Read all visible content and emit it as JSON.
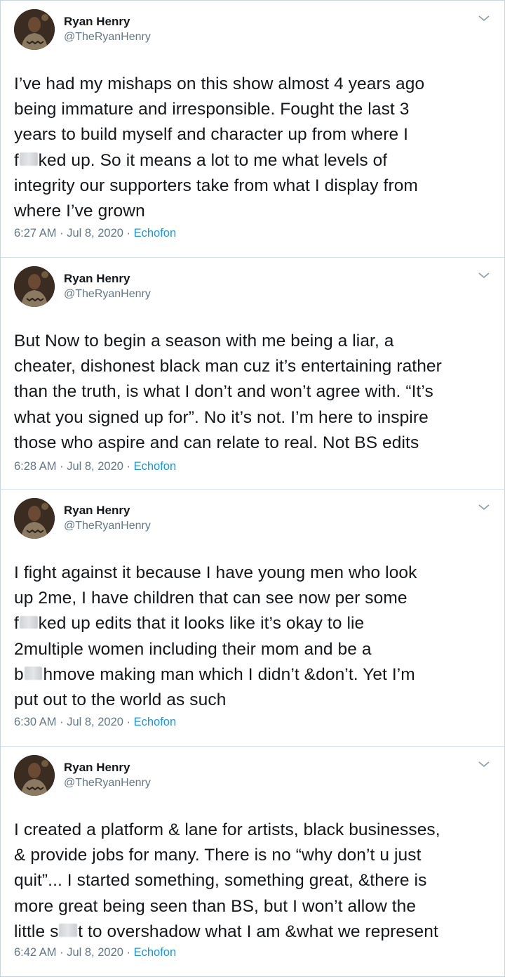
{
  "tweets": [
    {
      "display_name": "Ryan Henry",
      "handle": "@TheRyanHenry",
      "lines": [
        "I’ve had my mishaps on this show almost 4 years ago",
        "being immature and irresponsible. Fought the last 3",
        "years to build myself and character up from where I",
        "f",
        "ked up. So it means a lot to me what levels of",
        "integrity our supporters take from what I display from",
        "where I’ve grown"
      ],
      "time": "6:27 AM · Jul 8, 2020 · ",
      "source": "Echofon"
    },
    {
      "display_name": "Ryan Henry",
      "handle": "@TheRyanHenry",
      "lines": [
        "But  Now to begin a season with me being a liar, a",
        "cheater, dishonest black man cuz it’s entertaining rather",
        "than the truth, is what I don’t and won’t agree with. “It’s",
        "what you signed up for”. No it’s not. I’m here to inspire",
        "those who aspire and can relate to real. Not BS edits"
      ],
      "time": "6:28 AM · Jul 8, 2020 · ",
      "source": "Echofon"
    },
    {
      "display_name": "Ryan Henry",
      "handle": "@TheRyanHenry",
      "lines": [
        "I fight against it because I have young men who look",
        "up 2me, I have children that can see now per some",
        "f",
        "ked up edits that it looks like it’s okay to lie",
        "2multiple women including their mom and be a",
        "b",
        "hmove making man which I didn’t &don’t. Yet I’m",
        "put out to the world as such"
      ],
      "time": "6:30 AM · Jul 8, 2020 · ",
      "source": "Echofon"
    },
    {
      "display_name": "Ryan Henry",
      "handle": "@TheRyanHenry",
      "lines": [
        "I created a platform & lane for artists, black businesses,",
        "& provide jobs for many. There is no “why don’t u just",
        "quit”... I started something, something great, &there is",
        "more great being seen than BS, but I won’t allow the",
        "little s",
        "t to overshadow what I am &what we represent"
      ],
      "time": "6:42 AM · Jul 8, 2020 · ",
      "source": "Echofon"
    }
  ],
  "icons": {
    "menu": "chevron-down-icon",
    "avatar": "profile-photo"
  },
  "colors": {
    "link": "#1b95e0",
    "muted": "#657786",
    "text": "#14171a",
    "border": "#d7dee4"
  }
}
